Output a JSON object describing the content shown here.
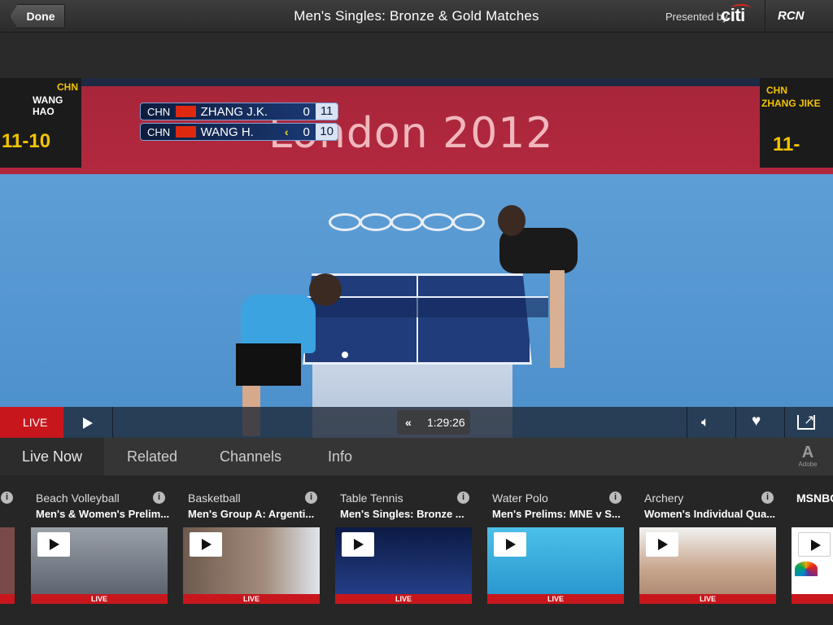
{
  "header": {
    "done_label": "Done",
    "title": "Men's Singles: Bronze & Gold Matches",
    "presented_by": "Presented by",
    "sponsor": "citi",
    "network": "RCN"
  },
  "video": {
    "arena_banner": "London 2012",
    "left_board": {
      "country": "CHN",
      "player": "WANG HAO",
      "score": "11-10"
    },
    "right_board": {
      "country": "CHN",
      "player": "ZHANG JIKE",
      "score": "11-"
    },
    "scoreboard": [
      {
        "country": "CHN",
        "name": "ZHANG J.K.",
        "games": "0",
        "points": "11",
        "serving": false
      },
      {
        "country": "CHN",
        "name": "WANG H.",
        "games": "0",
        "points": "10",
        "serving": true
      }
    ]
  },
  "controls": {
    "live_label": "LIVE",
    "time": "1:29:26"
  },
  "tabs": [
    {
      "label": "Live Now",
      "active": true
    },
    {
      "label": "Related",
      "active": false
    },
    {
      "label": "Channels",
      "active": false
    },
    {
      "label": "Info",
      "active": false
    }
  ],
  "adobe_label": "Adobe",
  "cards": [
    {
      "title": "Beach Volleyball",
      "subtitle": "Men's & Women's Prelim...",
      "live": "LIVE",
      "thumb_color": "#8a8f99"
    },
    {
      "title": "Basketball",
      "subtitle": "Men's Group A: Argenti...",
      "live": "LIVE",
      "thumb_color": "#6a5548"
    },
    {
      "title": "Table Tennis",
      "subtitle": "Men's Singles: Bronze ...",
      "live": "LIVE",
      "thumb_color": "#1a2c66"
    },
    {
      "title": "Water Polo",
      "subtitle": "Men's Prelims: MNE v S...",
      "live": "LIVE",
      "thumb_color": "#36b1df"
    },
    {
      "title": "Archery",
      "subtitle": "Women's Individual Qua...",
      "live": "LIVE",
      "thumb_color": "#c9b7a8"
    },
    {
      "title": "MSNBC",
      "subtitle": "",
      "live": "",
      "thumb_color": "#ffffff"
    }
  ],
  "icons": {
    "play": "play-icon",
    "rewind": "rewind-icon",
    "volume": "volume-icon",
    "favorite": "heart-icon",
    "share": "share-icon",
    "info": "info-icon"
  },
  "colors": {
    "live_red": "#c7171d",
    "header_bg": "#333333",
    "tabs_bg": "#353535"
  }
}
